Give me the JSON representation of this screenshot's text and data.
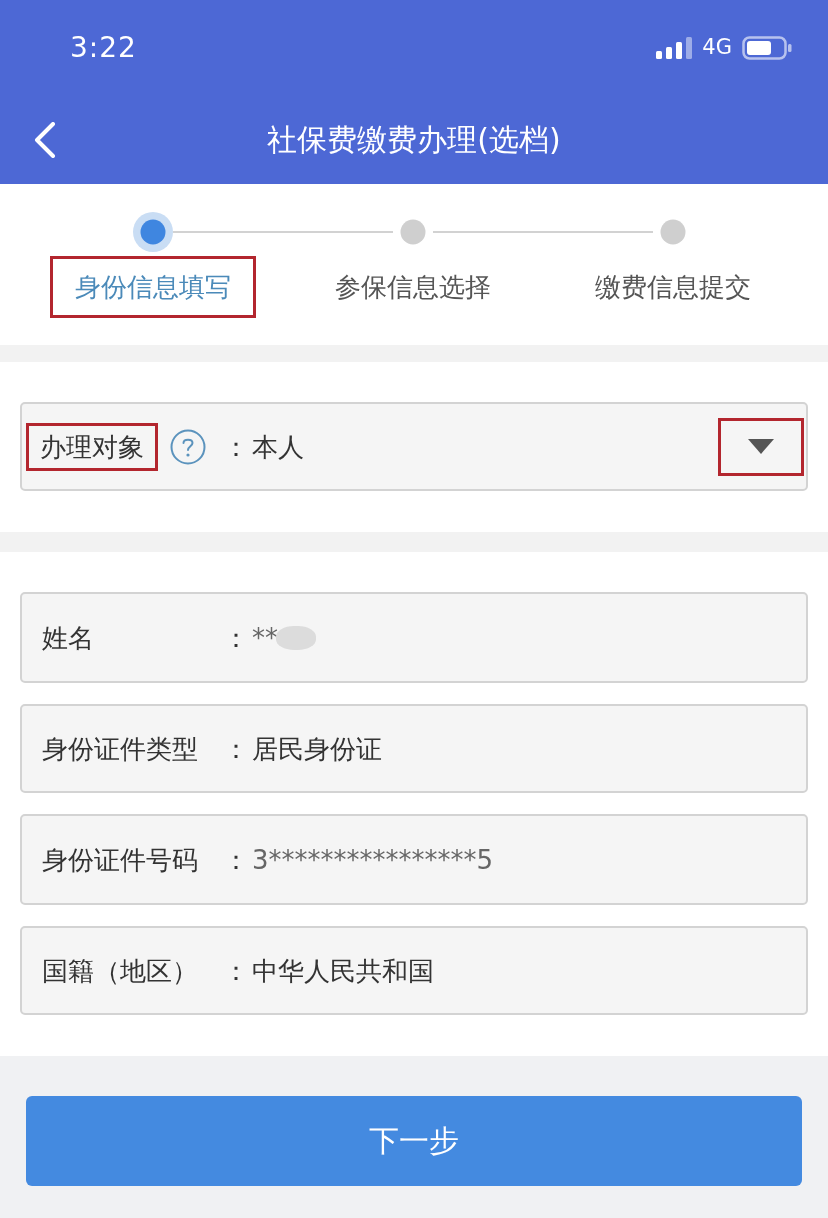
{
  "status_bar": {
    "time": "3:22",
    "network": "4G"
  },
  "header": {
    "title": "社保费缴费办理(选档)"
  },
  "steps": [
    {
      "label": "身份信息填写",
      "selected": true,
      "highlighted": true
    },
    {
      "label": "参保信息选择",
      "selected": false,
      "highlighted": false
    },
    {
      "label": "缴费信息提交",
      "selected": false,
      "highlighted": false
    }
  ],
  "subject_field": {
    "label": "办理对象",
    "label_highlighted": true,
    "separator": "：",
    "value": "本人",
    "caret_highlighted": true
  },
  "identity_fields": [
    {
      "label": "姓名",
      "separator": "：",
      "value": "**",
      "muted": true,
      "redacted": true
    },
    {
      "label": "身份证件类型",
      "separator": "：",
      "value": "居民身份证",
      "muted": false,
      "redacted": false
    },
    {
      "label": "身份证件号码",
      "separator": "：",
      "value": "3****************5",
      "muted": true,
      "redacted": false
    },
    {
      "label": "国籍（地区）",
      "separator": "：",
      "value": "中华人民共和国",
      "muted": false,
      "redacted": false
    }
  ],
  "next_button": {
    "label": "下一步"
  }
}
